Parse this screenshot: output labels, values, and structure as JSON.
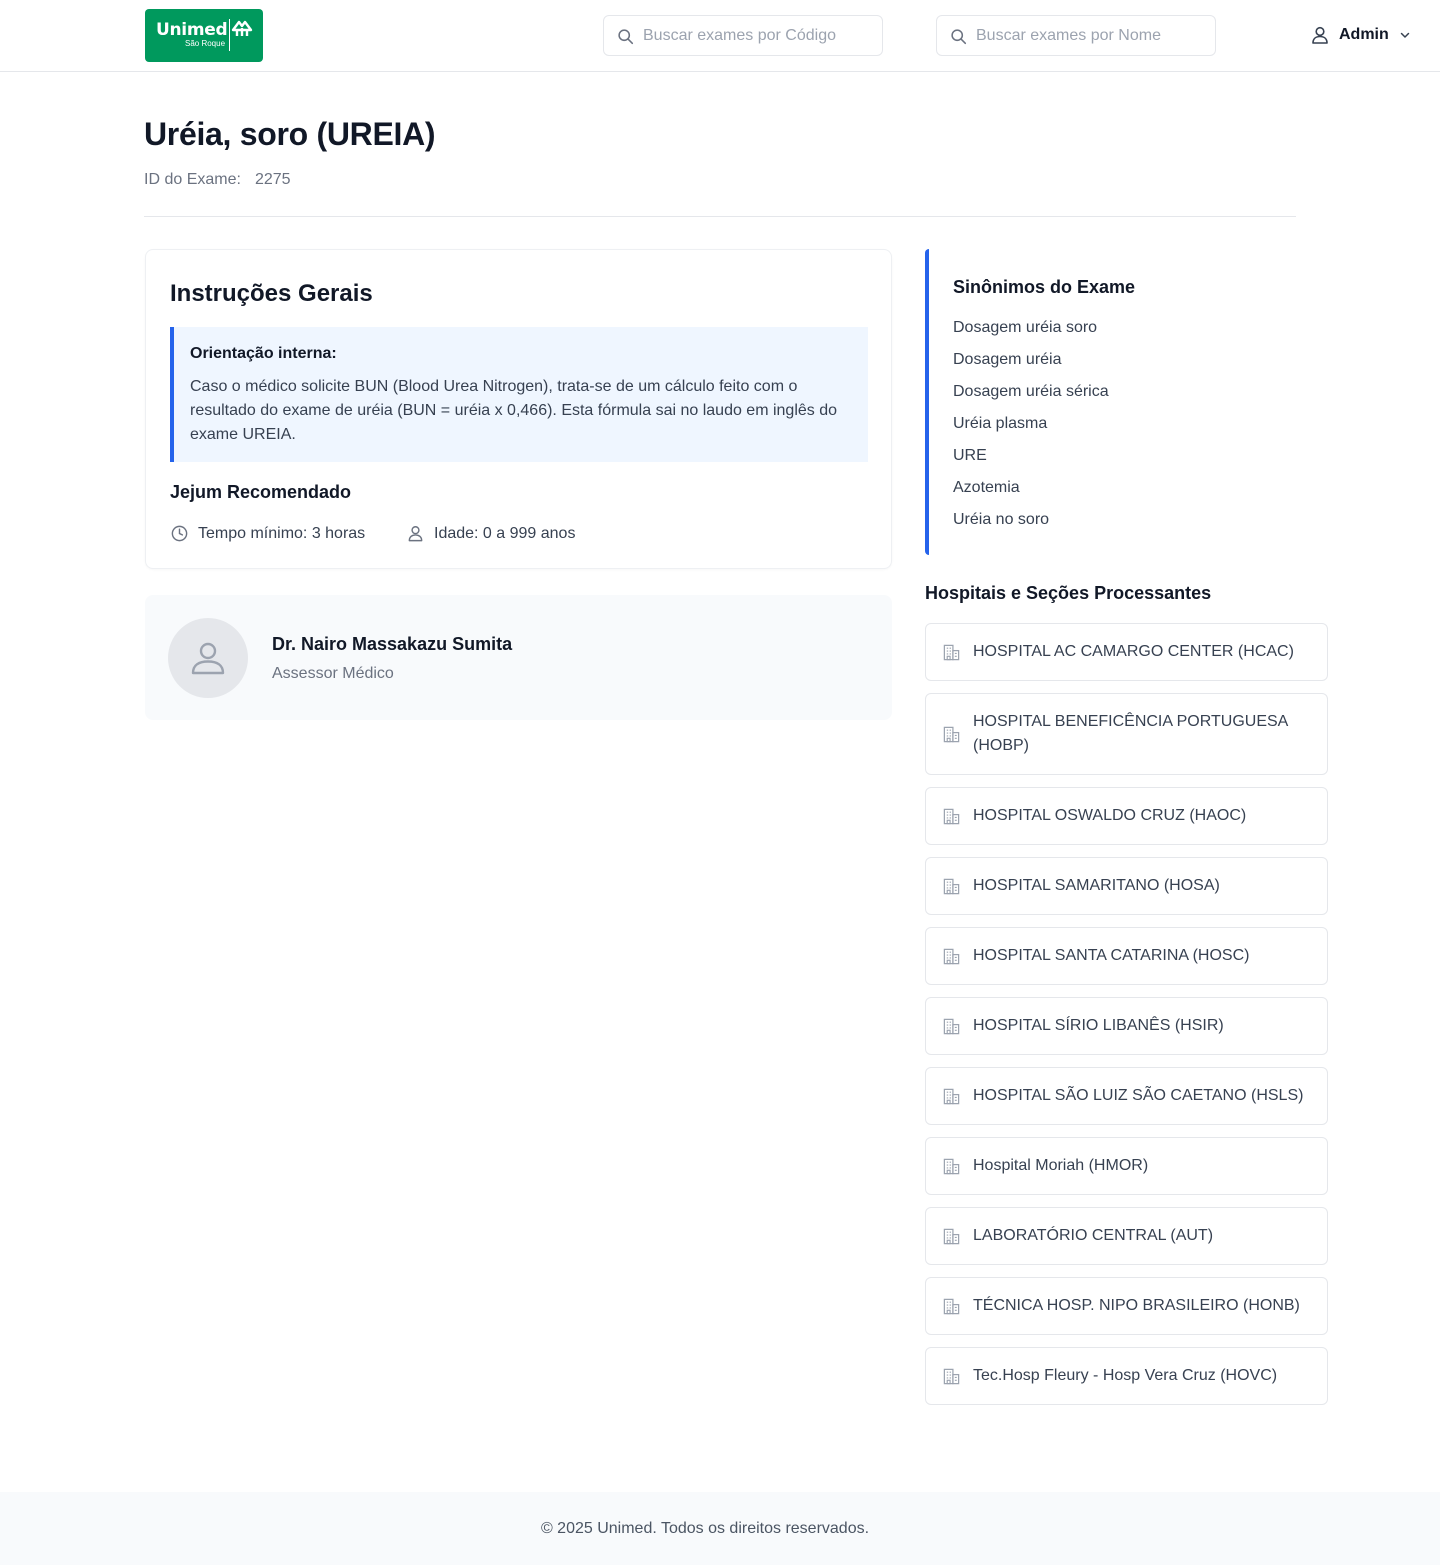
{
  "header": {
    "logo": {
      "brand": "Unimed",
      "subtitle": "São Roque"
    },
    "search_code": {
      "placeholder": "Buscar exames por Código"
    },
    "search_name": {
      "placeholder": "Buscar exames por Nome"
    },
    "user": {
      "name": "Admin"
    }
  },
  "exam": {
    "title": "Uréia, soro (UREIA)",
    "id_label": "ID do Exame:",
    "id_value": "2275"
  },
  "instructions": {
    "title": "Instruções Gerais",
    "note_title": "Orientação interna:",
    "note_text": "Caso o médico solicite BUN (Blood Urea Nitrogen), trata-se de um cálculo feito com o resultado do exame de uréia (BUN = uréia x 0,466). Esta fórmula sai no laudo em inglês do exame UREIA.",
    "fasting_title": "Jejum Recomendado",
    "fasting_time": "Tempo mínimo: 3 horas",
    "fasting_age": "Idade: 0 a 999 anos"
  },
  "doctor": {
    "name": "Dr. Nairo Massakazu Sumita",
    "role": "Assessor Médico"
  },
  "synonyms": {
    "title": "Sinônimos do Exame",
    "items": [
      "Dosagem uréia soro",
      "Dosagem uréia",
      "Dosagem uréia sérica",
      "Uréia plasma",
      "URE",
      "Azotemia",
      "Uréia no soro"
    ]
  },
  "hospitals": {
    "title": "Hospitais e Seções Processantes",
    "items": [
      "HOSPITAL AC CAMARGO CENTER (HCAC)",
      "HOSPITAL BENEFICÊNCIA PORTUGUESA (HOBP)",
      "HOSPITAL OSWALDO CRUZ (HAOC)",
      "HOSPITAL SAMARITANO (HOSA)",
      "HOSPITAL SANTA CATARINA (HOSC)",
      "HOSPITAL SÍRIO LIBANÊS (HSIR)",
      "HOSPITAL SÃO LUIZ SÃO CAETANO (HSLS)",
      "Hospital Moriah (HMOR)",
      "LABORATÓRIO CENTRAL (AUT)",
      "TÉCNICA HOSP. NIPO BRASILEIRO (HONB)",
      "Tec.Hosp Fleury - Hosp Vera Cruz (HOVC)"
    ]
  },
  "footer": {
    "text": "© 2025 Unimed. Todos os direitos reservados."
  },
  "colors": {
    "brand_green": "#00995d",
    "accent_blue": "#2563eb",
    "note_bg": "#eff6ff"
  }
}
